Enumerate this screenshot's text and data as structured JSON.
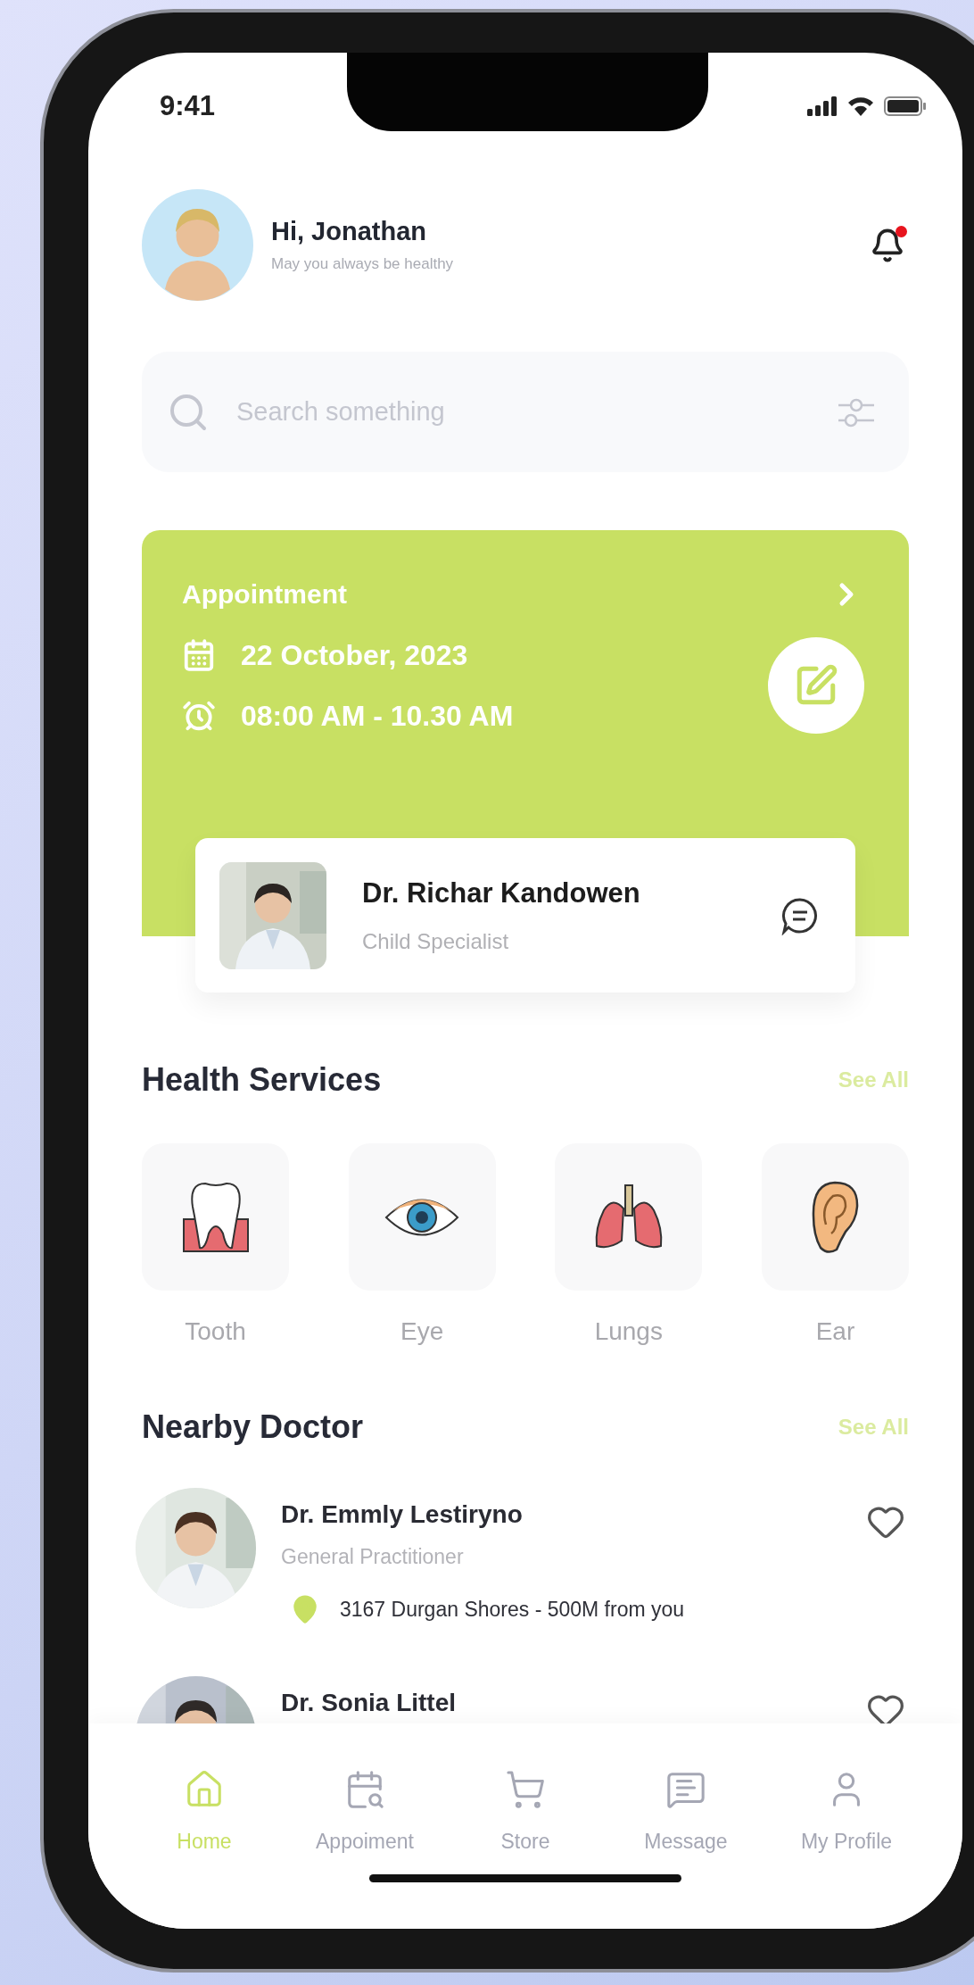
{
  "status_bar": {
    "time": "9:41"
  },
  "header": {
    "greeting": "Hi, Jonathan",
    "subtitle": "May you always be healthy",
    "notification": {
      "unread": true
    }
  },
  "search": {
    "placeholder": "Search something"
  },
  "appointment": {
    "title": "Appointment",
    "date": "22 October, 2023",
    "time": "08:00 AM - 10.30 AM",
    "doctor": {
      "name": "Dr. Richar Kandowen",
      "specialty": "Child Specialist"
    }
  },
  "health_services": {
    "title": "Health Services",
    "see_all": "See All",
    "items": [
      {
        "kind": "tooth",
        "label": "Tooth"
      },
      {
        "kind": "eye",
        "label": "Eye"
      },
      {
        "kind": "lungs",
        "label": "Lungs"
      },
      {
        "kind": "ear",
        "label": "Ear"
      }
    ]
  },
  "nearby_doctor": {
    "title": "Nearby Doctor",
    "see_all": "See All",
    "doctors": [
      {
        "name": "Dr. Emmly Lestiryno",
        "specialty": "General Practitioner",
        "location": "3167 Durgan Shores - 500M from you",
        "favorite": false
      },
      {
        "name": "Dr. Sonia Littel",
        "favorite": false
      }
    ]
  },
  "bottom_nav": [
    {
      "kind": "home",
      "label": "Home",
      "selected": true
    },
    {
      "kind": "appointment",
      "label": "Appoiment",
      "selected": false
    },
    {
      "kind": "store",
      "label": "Store",
      "selected": false
    },
    {
      "kind": "message",
      "label": "Message",
      "selected": false
    },
    {
      "kind": "profile",
      "label": "My Profile",
      "selected": false
    }
  ]
}
